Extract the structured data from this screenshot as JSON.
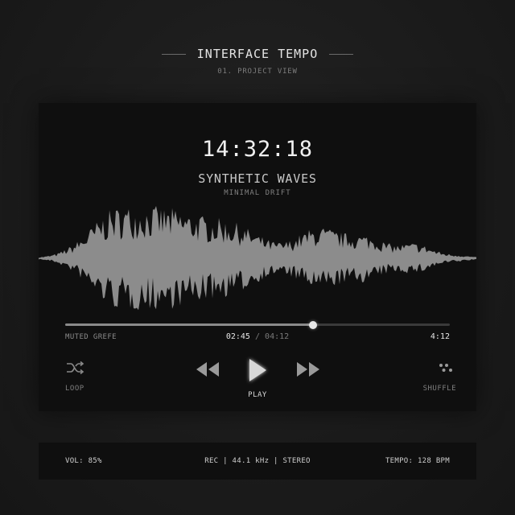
{
  "header": {
    "title": "INTERFACE TEMPO",
    "subtitle": "01. PROJECT VIEW"
  },
  "player": {
    "clock": "14:32:18",
    "track_title": "SYNTHETIC WAVES",
    "track_subtitle": "MINIMAL DRIFT",
    "waveform_icon": "audio-waveform",
    "progress_fraction": 0.645,
    "left_label": "MUTED GREFE",
    "current_time": "02:45",
    "time_separator": "/",
    "total_time": "04:12",
    "right_label": "4:12",
    "controls": {
      "loop_icon": "loop-icon",
      "loop_label": "LOOP",
      "rewind_icon": "rewind-icon",
      "play_icon": "play-icon",
      "play_label": "PLAY",
      "forward_icon": "fast-forward-icon",
      "shuffle_icon": "shuffle-icon",
      "shuffle_label": "SHUFFLE"
    }
  },
  "status_bar": {
    "volume": "VOL: 85%",
    "recording": "REC | 44.1 kHz | STEREO",
    "tempo": "TEMPO: 128 BPM"
  },
  "colors": {
    "background": "#1b1b1b",
    "panel": "#0f0f0f",
    "waveform": "#8c8c8c",
    "accent": "#e8e8e8"
  }
}
